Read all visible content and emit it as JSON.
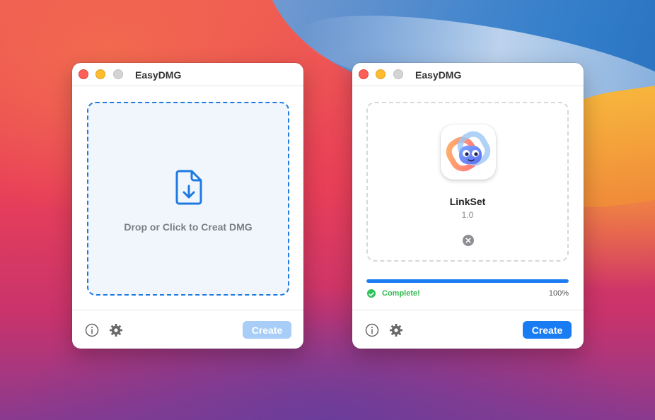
{
  "windows": [
    {
      "title": "EasyDMG",
      "dropzone": {
        "label": "Drop or Click to Creat DMG",
        "icon": "file-download-icon"
      },
      "footer": {
        "create_label": "Create",
        "create_enabled": false
      }
    },
    {
      "title": "EasyDMG",
      "app": {
        "name": "LinkSet",
        "version": "1.0",
        "icon": "linkset-app-icon"
      },
      "progress": {
        "percent_value": 100,
        "percent_label": "100%",
        "status": "Complete!"
      },
      "footer": {
        "create_label": "Create",
        "create_enabled": true
      }
    }
  ],
  "colors": {
    "accent": "#1a7cf2",
    "accent_disabled": "#a8cdf7",
    "success": "#30c05a",
    "close": "#fe5f57",
    "minimize": "#febc2e",
    "zoom_inactive": "#d4d4d4"
  }
}
